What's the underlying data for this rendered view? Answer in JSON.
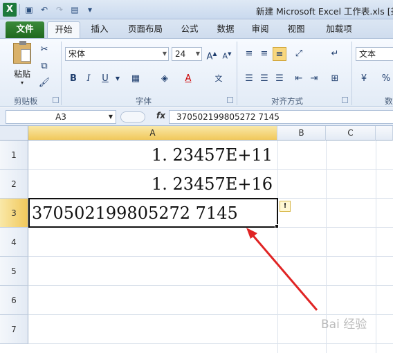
{
  "window": {
    "title": "新建 Microsoft Excel 工作表.xls  [兼",
    "app_icon": "X"
  },
  "tabs": [
    {
      "label": "文件"
    },
    {
      "label": "开始"
    },
    {
      "label": "插入"
    },
    {
      "label": "页面布局"
    },
    {
      "label": "公式"
    },
    {
      "label": "数据"
    },
    {
      "label": "审阅"
    },
    {
      "label": "视图"
    },
    {
      "label": "加载项"
    }
  ],
  "ribbon": {
    "clipboard": {
      "paste_label": "粘贴",
      "group_label": "剪贴板"
    },
    "font": {
      "name": "宋体",
      "size": "24",
      "group_label": "字体",
      "bold": "B",
      "italic": "I",
      "underline": "U"
    },
    "alignment": {
      "group_label": "对齐方式"
    },
    "number": {
      "format": "文本",
      "group_label": "数",
      "percent": "%"
    }
  },
  "formula_bar": {
    "name_box": "A3",
    "fx": "fx",
    "value": "370502199805272 7145"
  },
  "grid": {
    "columns": [
      "A",
      "B",
      "C"
    ],
    "rows": [
      "1",
      "2",
      "3",
      "4",
      "5",
      "6",
      "7"
    ],
    "cells": {
      "A1": "1. 23457E+11",
      "A2": "1. 23457E+16",
      "A3": "370502199805272 7145"
    }
  },
  "watermark": "Bai 经验",
  "colors": {
    "accent": "#f1c85b",
    "file_tab": "#20691f",
    "arrow": "#e02424"
  }
}
